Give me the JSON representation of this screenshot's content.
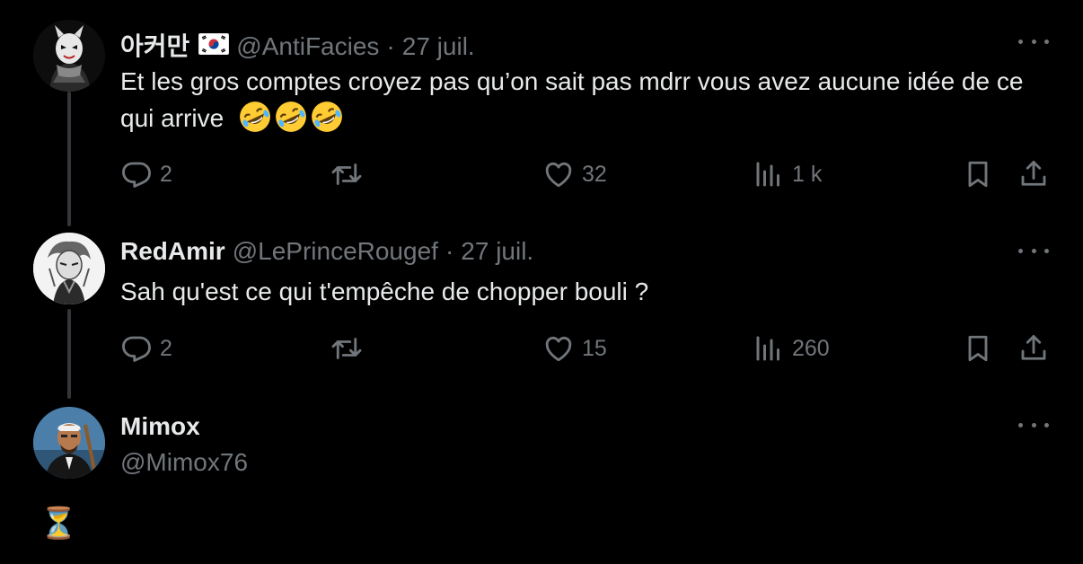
{
  "tweets": [
    {
      "name": "아커만",
      "flag_icon": "south-korea-flag",
      "handle": "@AntiFacies",
      "separator": "·",
      "date": "27 juil.",
      "text": "Et les gros comptes croyez pas qu’on sait pas mdrr vous avez aucune idée de ce qui arrive",
      "text_line2": "de ce qui arrive",
      "emoji": "🤣🤣🤣",
      "stats": {
        "replies": "2",
        "likes": "32",
        "views": "1 k"
      }
    },
    {
      "name": "RedAmir",
      "handle": "@LePrinceRougef",
      "separator": "·",
      "date": "27 juil.",
      "text": "Sah qu'est ce qui t'empêche de chopper bouli ?",
      "stats": {
        "replies": "2",
        "likes": "15",
        "views": "260"
      }
    },
    {
      "name": "Mimox",
      "handle": "@Mimox76",
      "text_emoji": "⏳"
    }
  ],
  "colors": {
    "background": "#000000",
    "text": "#e7e9ea",
    "muted": "#71767b",
    "thread_line": "#333639"
  }
}
